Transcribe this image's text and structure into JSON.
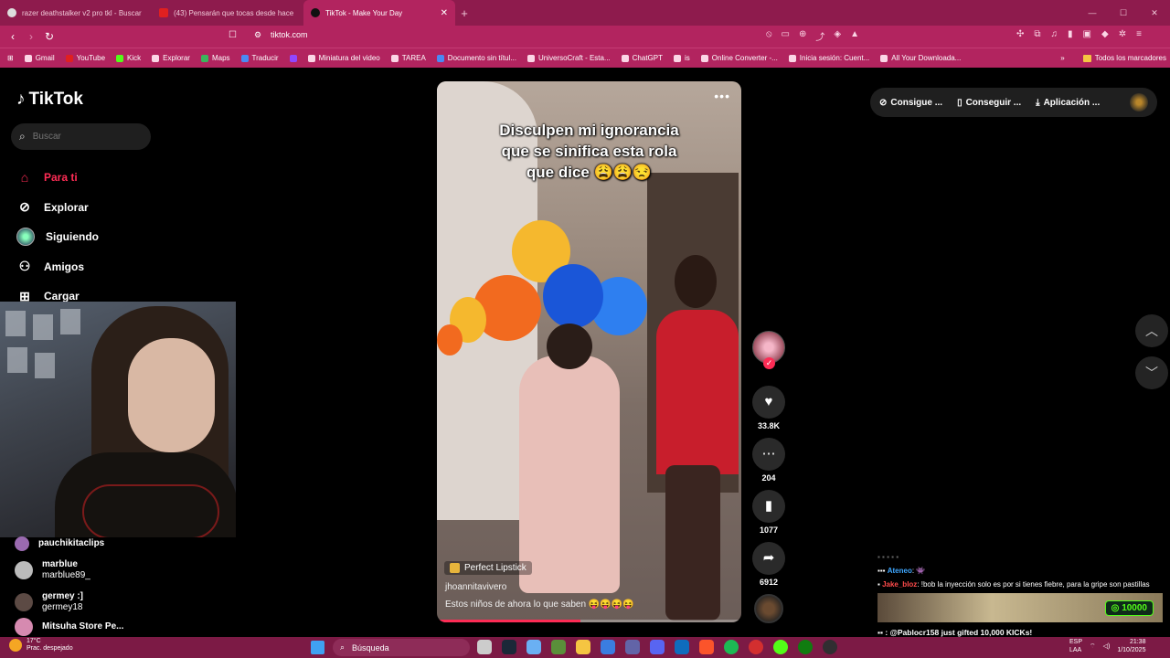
{
  "browser": {
    "tabs": [
      {
        "title": "razer deathstalker v2 pro tkl - Buscar",
        "icon": "google-icon",
        "active": false
      },
      {
        "title": "(43) Pensarán que tocas desde hace",
        "icon": "youtube-icon",
        "active": false
      },
      {
        "title": "TikTok - Make Your Day",
        "icon": "tiktok-icon",
        "active": true
      }
    ],
    "new_tab": "+",
    "url": "tiktok.com",
    "bookmarks": [
      "Gmail",
      "YouTube",
      "Kick",
      "Explorar",
      "Maps",
      "Traducir",
      "",
      "Miniatura del video",
      "TAREA",
      "Documento sin títul...",
      "UniversoCraft - Esta...",
      "ChatGPT",
      "is",
      "Online Converter -...",
      "Inicia sesión: Cuent...",
      "All Your Downloada..."
    ],
    "all_bookmarks": "Todos los marcadores",
    "accent": "#b2245f"
  },
  "tiktok": {
    "logo": "TikTok",
    "search_placeholder": "Buscar",
    "nav": [
      {
        "label": "Para ti",
        "icon": "home-icon",
        "active": true
      },
      {
        "label": "Explorar",
        "icon": "compass-icon",
        "active": false
      },
      {
        "label": "Siguiendo",
        "icon": "following-avatar",
        "active": false
      },
      {
        "label": "Amigos",
        "icon": "friends-icon",
        "active": false
      },
      {
        "label": "Cargar",
        "icon": "upload-icon",
        "active": false
      }
    ],
    "following": [
      {
        "name": "pauchikitaclips",
        "handle": ""
      },
      {
        "name": "marblue",
        "handle": "marblue89_"
      },
      {
        "name": "germey :]",
        "handle": "germey18"
      },
      {
        "name": "Mitsuha Store Pe...",
        "handle": ""
      }
    ],
    "video": {
      "caption_lines": [
        "Disculpen mi ignorancia",
        "que se sinifica esta rola",
        "que dice 😩😩😒"
      ],
      "music": "Perfect Lipstick",
      "author": "jhoannitavivero",
      "description": "Estos niños de ahora lo que saben 😝😝😝😝",
      "progress_percent": 47
    },
    "actions": {
      "likes": "33.8K",
      "comments": "204",
      "saves": "1077",
      "shares": "6912"
    },
    "top_right": [
      "Consigue ...",
      "Conseguir ...",
      "Aplicación ..."
    ],
    "accent": "#fe2c55"
  },
  "chat": {
    "lines": [
      {
        "user": "Ateneo",
        "text": ": 👾",
        "color": "#3fa7ff"
      },
      {
        "user": "Jake_bloz",
        "text": ": !bob la inyección solo es por si tienes fiebre, para la gripe son pastillas",
        "color": "#ff4b4b"
      }
    ],
    "gift_amount": "10000",
    "gift_message": ": @Pablocr158 just gifted 10,000 KICKs!"
  },
  "taskbar": {
    "temperature": "17°C",
    "weather": "Prac. despejado",
    "search": "Búsqueda",
    "lang": "ESP",
    "lang_sub": "LAA",
    "time": "21:38",
    "date": "1/10/2025"
  }
}
